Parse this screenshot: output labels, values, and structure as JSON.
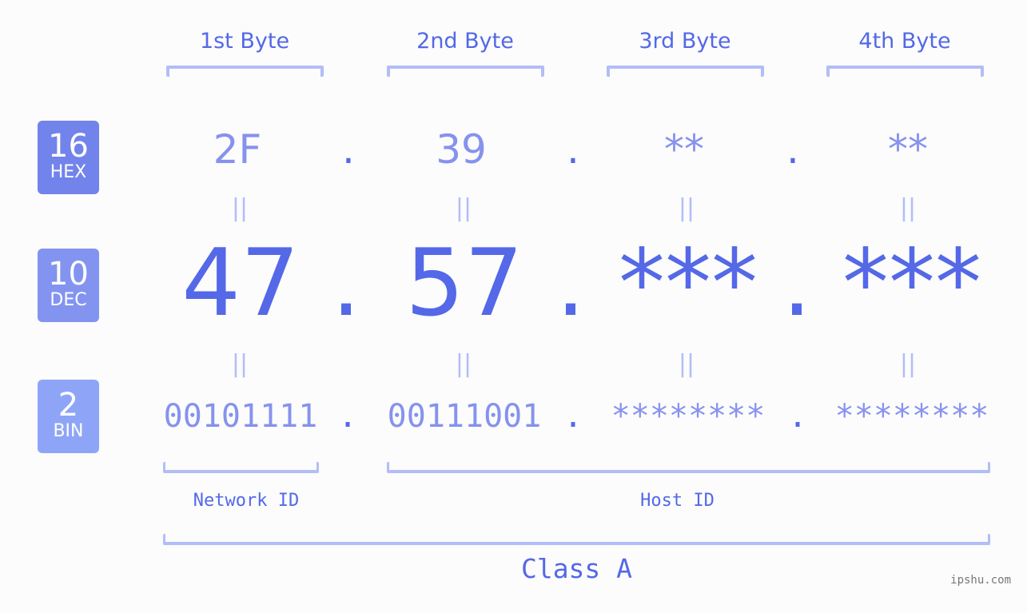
{
  "colors": {
    "primary": "#5468e8",
    "secondary": "#8692ee",
    "bracket": "#b3bdf7",
    "hex_badge": "#7283eb",
    "dec_badge": "#8394f0",
    "bin_badge": "#8ea5f7",
    "background": "#fbfcfb"
  },
  "byte_headers": [
    "1st Byte",
    "2nd Byte",
    "3rd Byte",
    "4th Byte"
  ],
  "bases": [
    {
      "number": "16",
      "name": "HEX"
    },
    {
      "number": "10",
      "name": "DEC"
    },
    {
      "number": "2",
      "name": "BIN"
    }
  ],
  "hex": {
    "octets": [
      "2F",
      "39",
      "**",
      "**"
    ],
    "separator": "."
  },
  "dec": {
    "octets": [
      "47",
      "57",
      "***",
      "***"
    ],
    "separator": "."
  },
  "bin": {
    "octets": [
      "00101111",
      "00111001",
      "********",
      "********"
    ],
    "separator": "."
  },
  "equals_symbol": "||",
  "network_id_label": "Network ID",
  "host_id_label": "Host ID",
  "class_label": "Class A",
  "watermark": "ipshu.com"
}
